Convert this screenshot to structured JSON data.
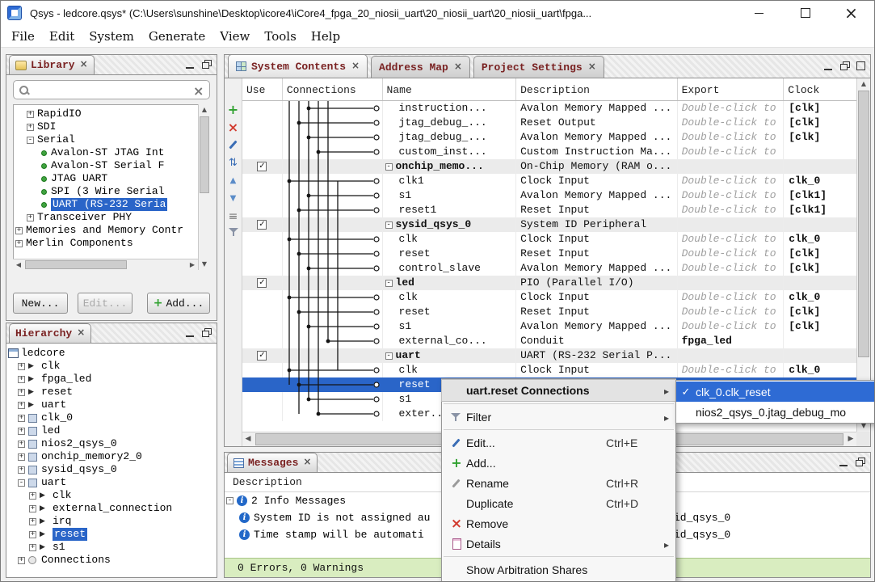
{
  "colors": {
    "accent_blue": "#2a65c8",
    "title_maroon": "#7a2222",
    "status_green": "#d9edc0",
    "selection_blue": "#2e6bd4"
  },
  "icons": {
    "close": "×",
    "minimize": "—",
    "maximize": "□",
    "check": "✓",
    "submenu_arrow": "▸",
    "tree_collapsed": "+",
    "tree_expanded": "-"
  },
  "window": {
    "title": "Qsys - ledcore.qsys* (C:\\Users\\sunshine\\Desktop\\icore4\\iCore4_fpga_20_niosii_uart\\20_niosii_uart\\20_niosii_uart\\fpga..."
  },
  "menubar": {
    "items": [
      "File",
      "Edit",
      "System",
      "Generate",
      "View",
      "Tools",
      "Help"
    ]
  },
  "library": {
    "title": "Library",
    "search_value": "",
    "tree": [
      {
        "label": "RapidIO",
        "pad": "16px",
        "exp": "+"
      },
      {
        "label": "SDI",
        "pad": "16px",
        "exp": "+"
      },
      {
        "label": "Serial",
        "pad": "16px",
        "exp": "-"
      },
      {
        "label": "Avalon-ST JTAG Int",
        "pad": "34px",
        "bullet": true
      },
      {
        "label": "Avalon-ST Serial F",
        "pad": "34px",
        "bullet": true
      },
      {
        "label": "JTAG UART",
        "pad": "34px",
        "bullet": true
      },
      {
        "label": "SPI (3 Wire Serial",
        "pad": "34px",
        "bullet": true
      },
      {
        "label": "UART (RS-232 Seria",
        "pad": "34px",
        "bullet": true,
        "selected": true
      },
      {
        "label": "Transceiver PHY",
        "pad": "16px",
        "exp": "+"
      },
      {
        "label": "Memories and Memory Contr",
        "pad": "2px",
        "exp": "+"
      },
      {
        "label": "Merlin Components",
        "pad": "2px",
        "exp": "+"
      }
    ],
    "buttons": {
      "new": "New...",
      "edit": "Edit...",
      "add": "Add..."
    }
  },
  "hierarchy": {
    "title": "Hierarchy",
    "tree": [
      {
        "label": "ledcore",
        "pad": "2px",
        "icon": "root"
      },
      {
        "label": "clk",
        "pad": "14px",
        "exp": "+",
        "icon": "iface"
      },
      {
        "label": "fpga_led",
        "pad": "14px",
        "exp": "+",
        "icon": "iface"
      },
      {
        "label": "reset",
        "pad": "14px",
        "exp": "+",
        "icon": "iface"
      },
      {
        "label": "uart",
        "pad": "14px",
        "exp": "+",
        "icon": "iface"
      },
      {
        "label": "clk_0",
        "pad": "14px",
        "exp": "+",
        "icon": "module"
      },
      {
        "label": "led",
        "pad": "14px",
        "exp": "+",
        "icon": "module"
      },
      {
        "label": "nios2_qsys_0",
        "pad": "14px",
        "exp": "+",
        "icon": "module"
      },
      {
        "label": "onchip_memory2_0",
        "pad": "14px",
        "exp": "+",
        "icon": "module"
      },
      {
        "label": "sysid_qsys_0",
        "pad": "14px",
        "exp": "+",
        "icon": "module"
      },
      {
        "label": "uart",
        "pad": "14px",
        "exp": "-",
        "icon": "module"
      },
      {
        "label": "clk",
        "pad": "28px",
        "exp": "+",
        "icon": "iface"
      },
      {
        "label": "external_connection",
        "pad": "28px",
        "exp": "+",
        "icon": "iface"
      },
      {
        "label": "irq",
        "pad": "28px",
        "exp": "+",
        "icon": "iface"
      },
      {
        "label": "reset",
        "pad": "28px",
        "exp": "+",
        "icon": "iface",
        "selected": true
      },
      {
        "label": "s1",
        "pad": "28px",
        "exp": "+",
        "icon": "iface"
      },
      {
        "label": "Connections",
        "pad": "14px",
        "exp": "+",
        "icon": "conn"
      }
    ]
  },
  "main": {
    "tabs": [
      {
        "label": "System Contents",
        "active": true,
        "icon": true
      },
      {
        "label": "Address Map"
      },
      {
        "label": "Project Settings"
      }
    ]
  },
  "contents_table": {
    "columns": [
      "Use",
      "Connections",
      "Name",
      "Description",
      "Export",
      "Clock"
    ],
    "rows": [
      {
        "pad": "20px",
        "name": "instruction...",
        "desc": "Avalon Memory Mapped ...",
        "export": "Double-click to",
        "clock": "[clk]"
      },
      {
        "pad": "20px",
        "name": "jtag_debug_...",
        "desc": "Reset Output",
        "export": "Double-click to",
        "clock": "[clk]"
      },
      {
        "pad": "20px",
        "name": "jtag_debug_...",
        "desc": "Avalon Memory Mapped ...",
        "export": "Double-click to",
        "clock": "[clk]"
      },
      {
        "pad": "20px",
        "name": "custom_inst...",
        "desc": "Custom Instruction Ma...",
        "export": "Double-click to",
        "clock": ""
      },
      {
        "pad": "3px",
        "use": "1",
        "exp": "-",
        "module": true,
        "name": "onchip_memo...",
        "desc": "On-Chip Memory (RAM o...",
        "export": "",
        "clock": ""
      },
      {
        "pad": "20px",
        "name": "clk1",
        "desc": "Clock Input",
        "export": "Double-click to",
        "clock": "clk_0"
      },
      {
        "pad": "20px",
        "name": "s1",
        "desc": "Avalon Memory Mapped ...",
        "export": "Double-click to",
        "clock": "[clk1]"
      },
      {
        "pad": "20px",
        "name": "reset1",
        "desc": "Reset Input",
        "export": "Double-click to",
        "clock": "[clk1]"
      },
      {
        "pad": "3px",
        "use": "1",
        "exp": "-",
        "module": true,
        "name": "sysid_qsys_0",
        "desc": "System ID Peripheral",
        "export": "",
        "clock": ""
      },
      {
        "pad": "20px",
        "name": "clk",
        "desc": "Clock Input",
        "export": "Double-click to",
        "clock": "clk_0"
      },
      {
        "pad": "20px",
        "name": "reset",
        "desc": "Reset Input",
        "export": "Double-click to",
        "clock": "[clk]"
      },
      {
        "pad": "20px",
        "name": "control_slave",
        "desc": "Avalon Memory Mapped ...",
        "export": "Double-click to",
        "clock": "[clk]"
      },
      {
        "pad": "3px",
        "use": "1",
        "exp": "-",
        "module": true,
        "name": "led",
        "desc": "PIO (Parallel I/O)",
        "export": "",
        "clock": ""
      },
      {
        "pad": "20px",
        "name": "clk",
        "desc": "Clock Input",
        "export": "Double-click to",
        "clock": "clk_0"
      },
      {
        "pad": "20px",
        "name": "reset",
        "desc": "Reset Input",
        "export": "Double-click to",
        "clock": "[clk]"
      },
      {
        "pad": "20px",
        "name": "s1",
        "desc": "Avalon Memory Mapped ...",
        "export": "Double-click to",
        "clock": "[clk]"
      },
      {
        "pad": "20px",
        "name": "external_co...",
        "desc": "Conduit",
        "export": "fpga_led",
        "export_bold": true,
        "clock": ""
      },
      {
        "pad": "3px",
        "use": "1",
        "exp": "-",
        "module": true,
        "name": "uart",
        "desc": "UART (RS-232 Serial P...",
        "export": "",
        "clock": ""
      },
      {
        "pad": "20px",
        "name": "clk",
        "desc": "Clock Input",
        "export": "Double-click to",
        "clock": "clk_0"
      },
      {
        "pad": "20px",
        "name": "reset",
        "desc": "",
        "export": "",
        "clock": "",
        "selected": true
      },
      {
        "pad": "20px",
        "name": "s1",
        "desc": "",
        "export": "",
        "clock": ""
      },
      {
        "pad": "20px",
        "name": "exter...",
        "desc": "",
        "export": "",
        "clock": ""
      }
    ]
  },
  "context_menu": {
    "items": [
      {
        "label": "uart.reset Connections",
        "open": true,
        "arrow": true
      },
      {
        "sep": true
      },
      {
        "label": "Filter",
        "icon": "filter",
        "arrow": true
      },
      {
        "sep": true
      },
      {
        "label": "Edit...",
        "icon": "edit",
        "shortcut": "Ctrl+E"
      },
      {
        "label": "Add...",
        "icon": "add"
      },
      {
        "label": "Rename",
        "icon": "rename",
        "shortcut": "Ctrl+R"
      },
      {
        "label": "Duplicate",
        "shortcut": "Ctrl+D"
      },
      {
        "label": "Remove",
        "icon": "remove"
      },
      {
        "label": "Details",
        "icon": "details",
        "arrow": true
      },
      {
        "sep": true
      },
      {
        "label": "Show Arbitration Shares"
      }
    ],
    "submenu_items": [
      {
        "label": "clk_0.clk_reset",
        "checked": true,
        "selected": true
      },
      {
        "label": "nios2_qsys_0.jtag_debug_mo",
        "checked": false
      }
    ]
  },
  "messages": {
    "title": "Messages",
    "column_header": "Description",
    "rows": [
      {
        "exp": "-",
        "icon": true,
        "pad": "2px",
        "text": "2 Info Messages",
        "right": ""
      },
      {
        "icon": true,
        "pad": "18px",
        "text": "System ID is not assigned au",
        "right": "id_qsys_0"
      },
      {
        "icon": true,
        "pad": "18px",
        "text": "Time stamp will be automati",
        "right": "id_qsys_0"
      }
    ],
    "status": "0 Errors, 0 Warnings"
  }
}
